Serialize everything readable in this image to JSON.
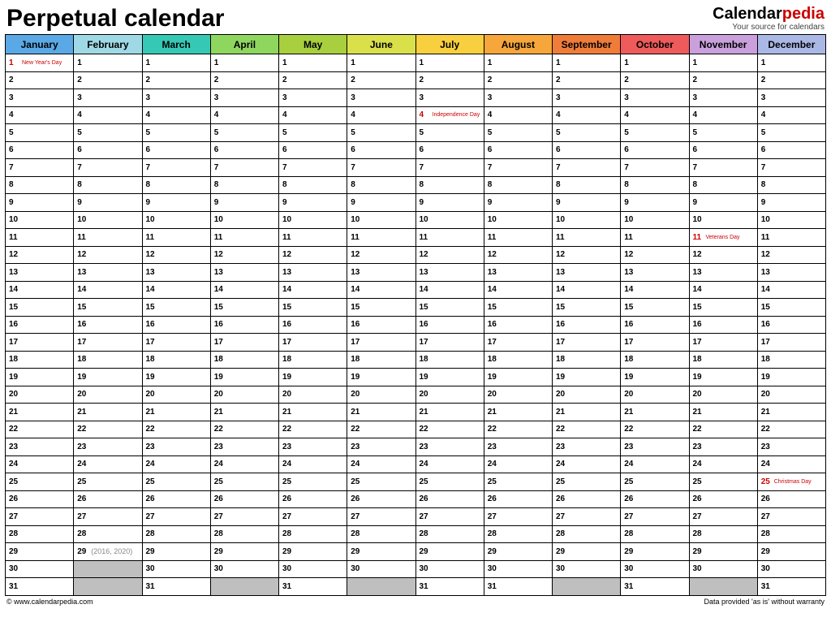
{
  "title": "Perpetual calendar",
  "brand": {
    "part1": "Calendar",
    "part2": "pedia",
    "tagline": "Your source for calendars"
  },
  "footer": {
    "left": "© www.calendarpedia.com",
    "right": "Data provided 'as is' without warranty"
  },
  "months": [
    {
      "name": "January",
      "color": "#5aa9e6",
      "days": 31
    },
    {
      "name": "February",
      "color": "#9fd9e6",
      "days": 29
    },
    {
      "name": "March",
      "color": "#35c9b5",
      "days": 31
    },
    {
      "name": "April",
      "color": "#8fd65f",
      "days": 30
    },
    {
      "name": "May",
      "color": "#a8cf3d",
      "days": 31
    },
    {
      "name": "June",
      "color": "#d9e04a",
      "days": 30
    },
    {
      "name": "July",
      "color": "#f8cf3e",
      "days": 31
    },
    {
      "name": "August",
      "color": "#f6a63a",
      "days": 31
    },
    {
      "name": "September",
      "color": "#f07c3a",
      "days": 30
    },
    {
      "name": "October",
      "color": "#ef5a5a",
      "days": 31
    },
    {
      "name": "November",
      "color": "#c9a0dc",
      "days": 30
    },
    {
      "name": "December",
      "color": "#aab8e6",
      "days": 31
    }
  ],
  "max_rows": 31,
  "holidays": {
    "0": {
      "1": "New Year's Day"
    },
    "6": {
      "4": "Independence Day"
    },
    "10": {
      "11": "Veterans Day"
    },
    "11": {
      "25": "Christmas Day"
    }
  },
  "annotations": {
    "1": {
      "29": "(2016, 2020)"
    }
  }
}
